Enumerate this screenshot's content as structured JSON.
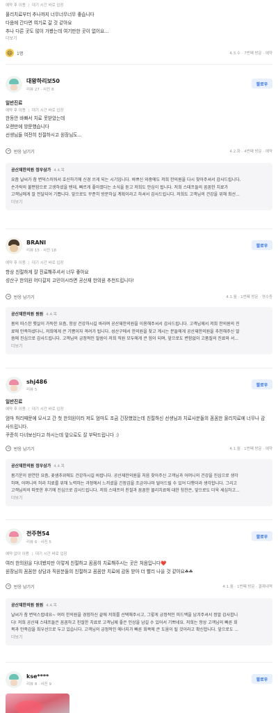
{
  "top_fragment": {
    "meta": [
      "예약 후 이용",
      "대기 시간 바로 입장"
    ],
    "lines": [
      "물리치료부터 추나까지 너무너무너무 좋습니다",
      "다음에 간다면 여기로 갈 것 같아요",
      "추나 다른 곳도 많이 가봤는데 여기만한 곳이 없어요..."
    ],
    "more": "더보기",
    "reaction_count": "1명",
    "meta_right": "4.3.수 · 7번째 방문 · 예약"
  },
  "reviews": [
    {
      "name": "대왕하리보50",
      "stats": "리뷰 27 · 사진 8",
      "follow": "팔로우",
      "category": "일반진료",
      "meta": [
        "예약 후 이용",
        "대기 시간 바로 입장"
      ],
      "lines": [
        "한동안 바빠서 치료 못받았는데",
        "오랜만에 방문했습니다",
        "선생님들 여전히 친절하시고 원장님도..."
      ],
      "more": "더보기",
      "reply": "반응 남기기",
      "date": "4.2.화 · 4번째 방문 · 예약",
      "owner_name": "공산재한의원 정우삼가",
      "owner_date": "4.4.목",
      "owner_lines": [
        "요즘 날씨가 참 변덕스러워서 호신하기에 신경 쓰게 되는 시기입니다. 바쁘신 와중에도 저희 한의원을 다시 찾아주셔서 감사드립니다.",
        "손가락의 불편함으로 고생하셨을 텐데, 빠르게 좋아졌다는 소식을 듣고 저희도 안심이 됩니다. 저희 스태프들의 꼼꼼한 치료가",
        "고객님에게 잘 전달되어 기쁩니다. 앞으로도 꾸준히 방문하실 계획이라고 하셔서 감사드립니다. 저희도 고객님의 건강을 위해 최선..."
      ],
      "owner_more": "더보기"
    },
    {
      "name": "BRANI",
      "stats": "리뷰 15 · 사진 18",
      "follow": "팔로우",
      "category": "",
      "meta": [
        "예약 후 이용",
        "대기 시간 바로 입장"
      ],
      "lines": [
        "항상 친절하게 잘 진료해주셔서 너무 좋아요",
        "성산구 한의원 어디갈지 고민이시라면 공산재 한의원 추천드립니다!"
      ],
      "more": "",
      "reply": "반응 남기기",
      "date": "4.1.월 · 1번째 방문 · 영수증",
      "owner_name": "공산재한의원 원원",
      "owner_date": "4.4.목",
      "owner_lines": [
        "봄의 따스한 햇살이 가득한 요즘, 항상 건강하시길 바라며 공산재한의원을 이용해주셔서 감사드립니다. 고객님께서 저희 한의원의 진",
        "료에 만족하셨다니, 저희에게 큰 기쁨이자 격려가 됩니다. 성산구에서 한의원을 찾고 계시는 분들에게 공산재한의원을 추천해주신 말",
        "씀에 진심으로 감사드립니다. 고객님의 긍정적인 말씀이 저희 직원 모두에게 큰 힘이 되며, 앞으로도 변함없이 고품질의 진료와 서..."
      ],
      "owner_more": "더보기"
    },
    {
      "name": "shj486",
      "stats": "리뷰 5",
      "follow": "팔로우",
      "category": "일반진료",
      "meta": [
        "예약 후 이용",
        "대기 시간 바로 입장"
      ],
      "lines": [
        "엄마 허리때문에 모시고 간 첫 한의원이라 저도 엄마도 조금 긴장했었는데 친절하신 선생님과 치료사분들의 꼼꼼한 물리치료에 너무나 감",
        "사드립니다.",
        "꾸준히 다녀보신다고 하시는데 앞으로도 잘 부탁드립니다 :)"
      ],
      "more": "",
      "reply": "반응 남기기",
      "date": "4.1.월 · 1번째 방문 · 예약",
      "owner_name": "공산재한의원 정우삼가",
      "owner_date": "4.4.목",
      "owner_lines": [
        "봄기운이 완연한 요즘, 꽃샘추위에도 건강하시길 바랍니다. 공산재한의원을 처음 찾아주신 고객님과 어머니의 건강을 진심으로 생각",
        "하며, 어머니의 허리 치료를 위해 노력하는 과정에서 느끼셨을 긴장감을 조금이나마 덜어드릴 수 있어 다행이라 생각합니다. 그리고",
        "고객님의의 따뜻한 후기에 진심으로 감사드립니다. 저희 스태프의 친절과 꼼꼼한 물리치료에 대한 칭찬은, 앞으로도 더욱 세심하고..."
      ],
      "owner_more": "더보기"
    },
    {
      "name": "전주현54",
      "stats": "리뷰 6 · 사진 5",
      "follow": "팔로우",
      "category": "",
      "meta": [
        "예약 없이 이용",
        "대기 시간 바로 입장"
      ],
      "lines": [
        "여러 한의원을 다녀봤지만 이렇게 친절하고 꼼꼼히 치료해주시는 곳은 처음입니다❤️",
        "원장님의 꼼꼼한 상담과 직원분들의 친절하고 꼼꼼한 치료에 감동 받아 더 빨리 나을 것 같아요☘☘"
      ],
      "more": "",
      "reply": "반응 남기기",
      "date": "4.1.월 · 1번째 방문 · 결제내역",
      "owner_name": "공산재한의원 원원",
      "owner_date": "4.4.목",
      "owner_lines": [
        "날씨가 참 변덕스럽네요~ 여러 한의원을 경험하신 끝에 저희를 선택해주시고, 그렇게 긍정적인 피드백을 남겨주셔서 정말 감사합니",
        "다! 저희 공산재 스태프들은 꼼꼼하고 친절한 치료로 고객님께 좋은 인상을 남길 수 있어서 기쁘네요. 저희는 항상 고객님의 빠른 회",
        "복과 만족감을 최우선으로 두고 있습니다. 고객님의 긍정적인 에너지가 빠른 회복에 큰 도움이 될 것이라고 확신합니다. 앞으로도 ..."
      ],
      "owner_more": "더보기"
    },
    {
      "name": "kse****",
      "stats": "리뷰 8 · 사진 9",
      "follow": "팔로우"
    }
  ]
}
